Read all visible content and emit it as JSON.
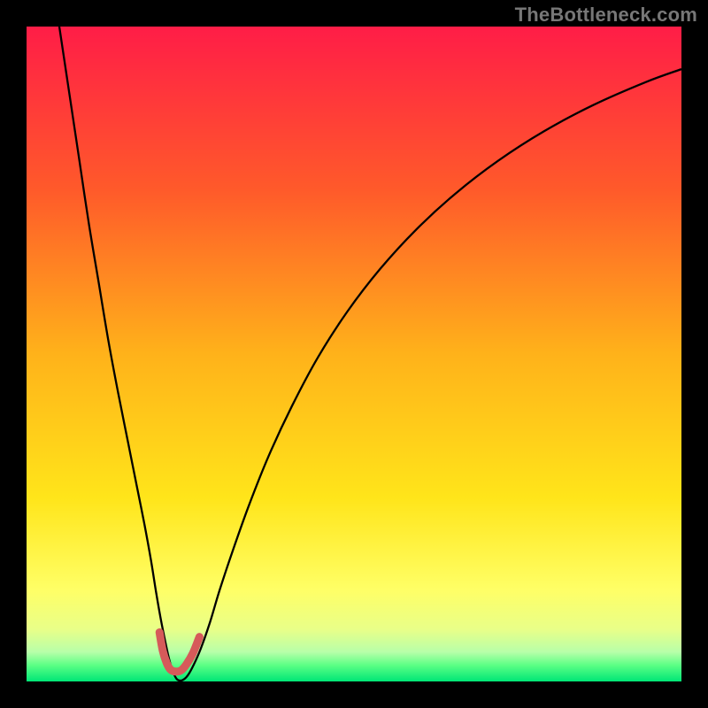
{
  "watermark": "TheBottleneck.com",
  "chart_data": {
    "type": "line",
    "title": "",
    "xlabel": "",
    "ylabel": "",
    "xlim": [
      0,
      100
    ],
    "ylim": [
      0,
      100
    ],
    "grid": false,
    "legend": false,
    "background_gradient_stops": [
      {
        "offset": 0.0,
        "color": "#ff1d47"
      },
      {
        "offset": 0.25,
        "color": "#ff5a2a"
      },
      {
        "offset": 0.5,
        "color": "#ffb21a"
      },
      {
        "offset": 0.72,
        "color": "#ffe51a"
      },
      {
        "offset": 0.86,
        "color": "#ffff66"
      },
      {
        "offset": 0.92,
        "color": "#e9ff88"
      },
      {
        "offset": 0.955,
        "color": "#b8ffa9"
      },
      {
        "offset": 0.975,
        "color": "#5cff85"
      },
      {
        "offset": 1.0,
        "color": "#00e676"
      }
    ],
    "series": [
      {
        "name": "bottleneck-curve",
        "color": "#000000",
        "width": 2.3,
        "x": [
          5.0,
          6.5,
          8.0,
          9.5,
          11.0,
          12.5,
          14.0,
          15.5,
          16.8,
          18.0,
          19.0,
          19.8,
          20.5,
          21.2,
          21.8,
          22.4,
          23.0,
          23.8,
          24.6,
          25.5,
          26.6,
          28.0,
          29.5,
          31.5,
          34.0,
          37.0,
          40.5,
          44.5,
          49.0,
          54.0,
          59.5,
          65.5,
          72.0,
          79.0,
          86.5,
          94.5,
          100.0
        ],
        "y": [
          100.0,
          90.0,
          80.0,
          70.0,
          61.0,
          52.0,
          44.0,
          36.5,
          30.0,
          24.0,
          18.5,
          13.5,
          9.5,
          6.0,
          3.3,
          1.4,
          0.3,
          0.2,
          0.9,
          2.5,
          5.0,
          9.0,
          14.0,
          20.0,
          27.0,
          34.5,
          42.0,
          49.5,
          56.5,
          63.0,
          69.0,
          74.5,
          79.5,
          84.0,
          88.0,
          91.5,
          93.5
        ]
      },
      {
        "name": "minimum-marker",
        "color": "#d65a5a",
        "width": 9,
        "linecap": "round",
        "x": [
          20.3,
          20.8,
          21.4,
          22.0,
          22.8,
          23.6,
          24.4,
          25.4,
          26.4
        ],
        "y": [
          7.5,
          4.7,
          2.8,
          1.8,
          1.5,
          1.7,
          2.6,
          4.3,
          6.8
        ]
      }
    ]
  }
}
